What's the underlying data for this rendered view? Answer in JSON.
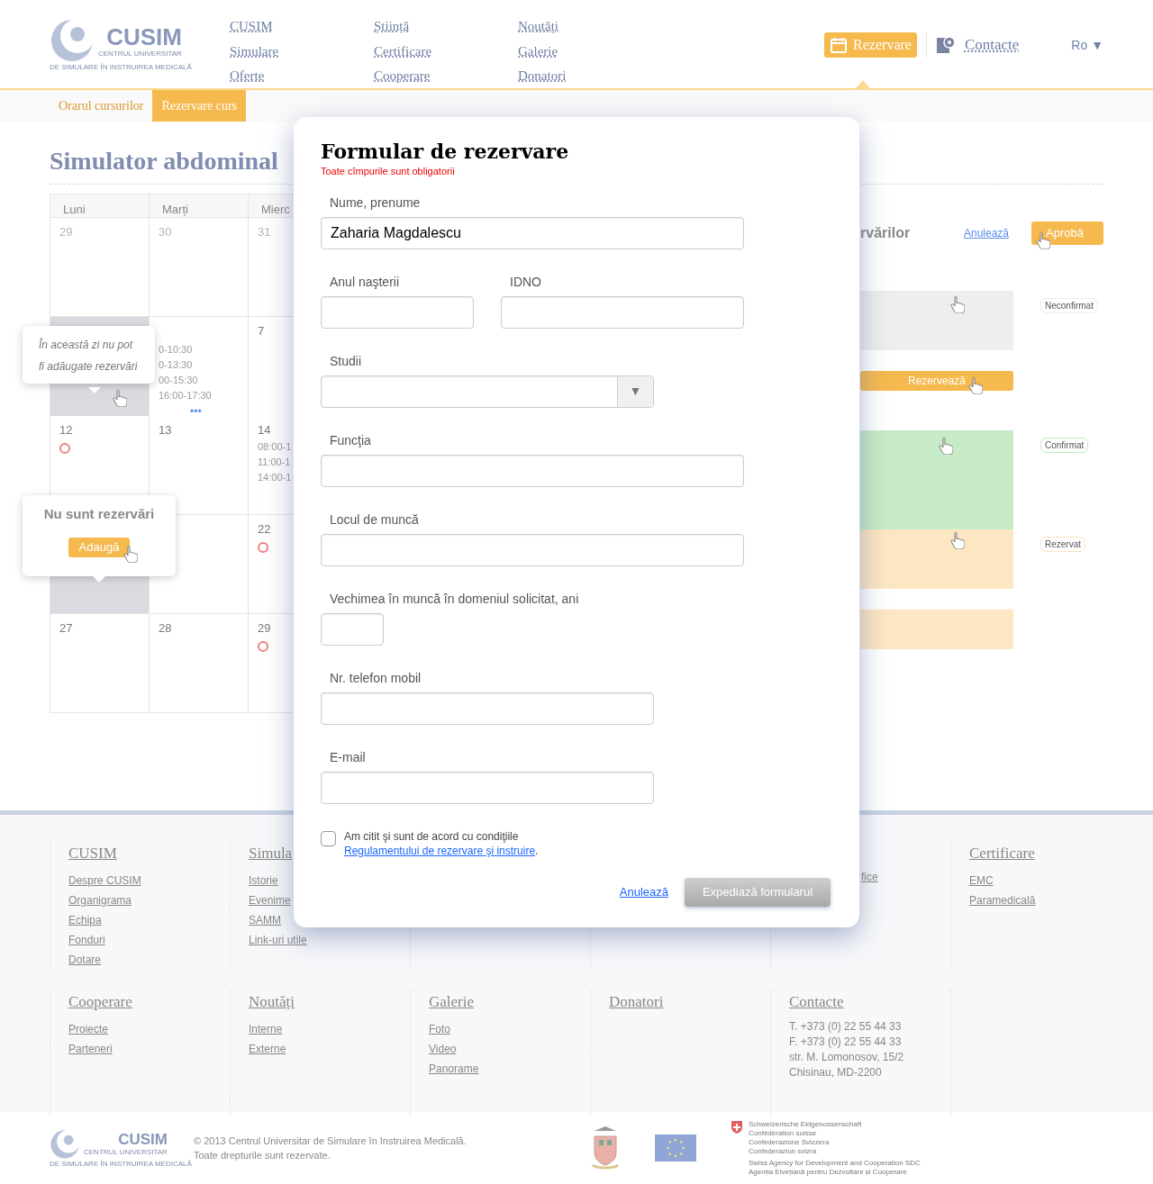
{
  "header": {
    "logo": {
      "title": "CUSIM",
      "subtitle": [
        "CENTRUL UNIVERSITAR",
        "DE SIMULARE ÎN INSTRUIREA MEDICALĂ"
      ]
    },
    "nav": [
      [
        "CUSIM",
        "Simulare",
        "Oferte"
      ],
      [
        "Știință",
        "Certificare",
        "Cooperare"
      ],
      [
        "Noutăți",
        "Galerie",
        "Donatori"
      ]
    ],
    "reserve_button": {
      "label": "Rezervare",
      "selected": true
    },
    "contacts_link": "Contacte",
    "language": "Ro ▼"
  },
  "subtabs": [
    {
      "label": "Orarul cursurilor",
      "selected": false
    },
    {
      "label": "Rezervare curs",
      "selected": true
    }
  ],
  "page_title": "Simulator abdominal",
  "calendar": {
    "weekdays": [
      "Luni",
      "Marți",
      "Mierc"
    ],
    "rows": [
      [
        {
          "day": "29",
          "marked": false,
          "disabled": false,
          "other_month": true
        },
        {
          "day": "30",
          "marked": false,
          "disabled": false,
          "other_month": true
        },
        {
          "day": "31",
          "marked": false,
          "disabled": false,
          "other_month": true
        }
      ],
      [
        {
          "marked": false,
          "disabled": true
        },
        {
          "times": [
            "0-10:30",
            "0-13:30",
            "00-15:30",
            "16:00-17:30"
          ],
          "more": "•••",
          "marked": false,
          "disabled": false
        },
        {
          "day": "7",
          "marked": false,
          "disabled": false,
          "other_month": false
        }
      ],
      [
        {
          "day": "12",
          "marked": true,
          "disabled": false,
          "other_month": false
        },
        {
          "day": "13",
          "marked": false,
          "disabled": false,
          "other_month": false
        },
        {
          "day": "14",
          "times": [
            "08:00-1",
            "11:00-1",
            "14:00-1"
          ],
          "marked": false,
          "disabled": false,
          "other_month": false
        }
      ],
      [
        {
          "marked": false,
          "disabled": true
        },
        {
          "marked": false,
          "disabled": false
        },
        {
          "day": "22",
          "marked": true,
          "disabled": false,
          "other_month": false
        }
      ],
      [
        {
          "day": "27",
          "marked": false,
          "disabled": false,
          "other_month": false
        },
        {
          "day": "28",
          "marked": false,
          "disabled": false,
          "other_month": false
        },
        {
          "day": "29",
          "marked": true,
          "disabled": false,
          "other_month": false
        }
      ]
    ],
    "tooltip": "În această zi nu pot fi adăugate rezervări",
    "popover": {
      "title": "Nu sunt rezervări",
      "button": "Adaugă"
    }
  },
  "schedule_panel": {
    "heading": "rvărilor",
    "cancel": "Anulează",
    "approve": "Aprobă",
    "items": [
      {
        "kind": "block",
        "color": "#eeeeee",
        "badge": "Neconfirmat"
      },
      {
        "kind": "button",
        "label": "Rezervează"
      },
      {
        "kind": "block",
        "color": "#c6ebc6",
        "badge": "Confirmat"
      },
      {
        "kind": "block",
        "color": "#fde6c2",
        "badge": "Rezervat"
      },
      {
        "kind": "block",
        "color": "#fde6c2"
      }
    ]
  },
  "footer": {
    "rows": [
      [
        {
          "heading": "CUSIM",
          "links": [
            "Despre CUSIM",
            "Organigrama",
            "Echipa",
            "Fonduri",
            "Dotare"
          ]
        },
        {
          "heading": "Simula",
          "links": [
            "Istorie",
            "Evenime",
            "SAMM",
            "Link-uri utile"
          ]
        },
        {
          "heading": "Certificare",
          "links": [
            "EMC",
            "Paramedicală"
          ]
        }
      ],
      [
        {
          "heading": "Cooperare",
          "links": [
            "Proiecte",
            "Parteneri"
          ]
        },
        {
          "heading": "Noutăți",
          "links": [
            "Interne",
            "Externe"
          ]
        },
        {
          "heading": "Galerie",
          "links": [
            "Foto",
            "Video",
            "Panorame"
          ]
        },
        {
          "heading": "Donatori"
        },
        {
          "heading": "Contacte",
          "lines": [
            "T. +373 (0) 22 55 44 33",
            "F. +373 (0) 22 55 44 33",
            "str. M. Lomonosov, 15/2",
            "Chisinau, MD-2200"
          ]
        }
      ]
    ],
    "cut_link": "fice",
    "logo": {
      "title": "CUSIM",
      "subtitle": [
        "CENTRUL UNIVERSITAR",
        "DE SIMULARE ÎN INSTRUIREA MEDICALĂ"
      ]
    },
    "copyright": [
      "© 2013 Centrul Universitar de Simulare în Instruirea Medicală.",
      "Toate drepturile sunt rezervate."
    ],
    "partner_text": [
      "Schweizerische Eidgenossenschaft",
      "Confédération suisse",
      "Confederazione Svizzera",
      "Confederaziun svizra",
      "Swiss Agency for Development and Cooperation SDC",
      "Agenția Elvețiană pentru Dezvoltare și Cooperare"
    ]
  },
  "modal": {
    "title": "Formular de rezervare",
    "note": "Toate cîmpurile sunt obligatorii",
    "rows": [
      [
        {
          "label": "Nume, prenume",
          "kind": "text",
          "value": "Zaharia Magdalescu"
        }
      ],
      [
        {
          "label": "Anul naşterii",
          "kind": "year"
        },
        {
          "label": "IDNO",
          "kind": "idno"
        }
      ],
      [
        {
          "label": "Studii",
          "kind": "select",
          "arrow": "▼"
        }
      ],
      [
        {
          "label": "Funcţia",
          "kind": "text"
        }
      ],
      [
        {
          "label": "Locul de muncă",
          "kind": "text"
        }
      ],
      [
        {
          "label": "Vechimea în muncă în domeniul solicitat, ani",
          "kind": "years"
        }
      ],
      [
        {
          "label": "Nr. telefon mobil",
          "kind": "tel"
        }
      ],
      [
        {
          "label": "E-mail",
          "kind": "email"
        }
      ]
    ],
    "agreement": {
      "checked": false,
      "text": "Am citit şi sunt de acord cu condiţiile ",
      "link": "Regulamentului de rezervare şi instruire",
      "end": "."
    },
    "cancel": "Anulează",
    "submit": {
      "label": "Expediază formularul",
      "disabled": true
    }
  }
}
